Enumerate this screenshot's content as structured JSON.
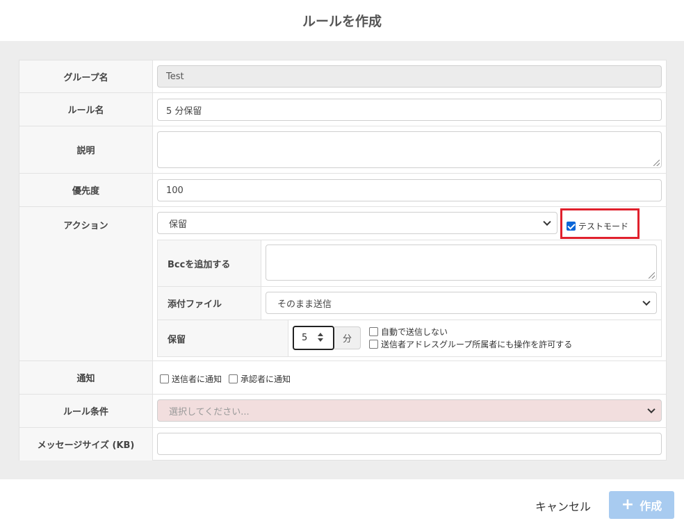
{
  "dialog": {
    "title": "ルールを作成"
  },
  "form": {
    "group_name": {
      "label": "グループ名",
      "value": "Test"
    },
    "rule_name": {
      "label": "ルール名",
      "value": "5 分保留"
    },
    "description": {
      "label": "説明",
      "value": ""
    },
    "priority": {
      "label": "優先度",
      "value": "100"
    },
    "action": {
      "label": "アクション",
      "selected": "保留",
      "test_mode_label": "テストモード",
      "test_mode_checked": true,
      "bcc": {
        "label": "Bccを追加する",
        "value": ""
      },
      "attachment": {
        "label": "添付ファイル",
        "selected": "そのまま送信"
      },
      "hold": {
        "label": "保留",
        "minutes": "5",
        "unit": "分",
        "no_auto_send_label": "自動で送信しない",
        "allow_group_label": "送信者アドレスグループ所属者にも操作を許可する"
      }
    },
    "notify": {
      "label": "通知",
      "sender_label": "送信者に通知",
      "approver_label": "承認者に通知"
    },
    "rule_condition": {
      "label": "ルール条件",
      "placeholder": "選択してください..."
    },
    "message_size": {
      "label": "メッセージサイズ (KB)",
      "value": ""
    }
  },
  "footer": {
    "cancel_label": "キャンセル",
    "create_label": "作成"
  },
  "colors": {
    "highlight": "#e0202c",
    "primary_disabled": "#a8cbf0",
    "condition_bg": "#f2dede",
    "checkbox_checked": "#0a66d8"
  },
  "icons": {
    "create_button_icon": "plus-icon",
    "select_arrow": "chevron-down-icon"
  }
}
